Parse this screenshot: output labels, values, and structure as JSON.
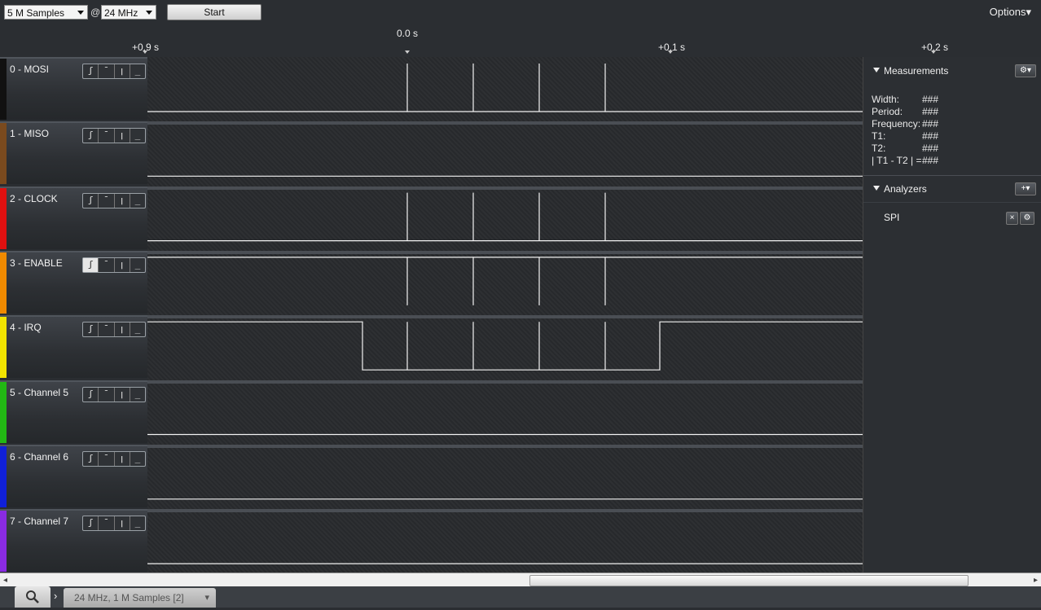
{
  "toolbar": {
    "samples_value": "5 M Samples",
    "at": "@",
    "rate_value": "24 MHz",
    "start_label": "Start",
    "options_label": "Options▾"
  },
  "ruler": {
    "ticks": [
      "+0.9 s",
      "0.0 s",
      "+0.1 s",
      "+0.2 s"
    ]
  },
  "channels": [
    {
      "name": "0 - MOSI",
      "color": "#111111"
    },
    {
      "name": "1 - MISO",
      "color": "#7a4a1e"
    },
    {
      "name": "2 - CLOCK",
      "color": "#e01010"
    },
    {
      "name": "3 - ENABLE",
      "color": "#f08a00"
    },
    {
      "name": "4 - IRQ",
      "color": "#f2e400"
    },
    {
      "name": "5 - Channel 5",
      "color": "#22b814"
    },
    {
      "name": "6 - Channel 6",
      "color": "#1020d8"
    },
    {
      "name": "7 - Channel 7",
      "color": "#8a2be2"
    }
  ],
  "trigger_glyphs": [
    "ʃ",
    "¯",
    "ꞁ",
    "_"
  ],
  "measurements": {
    "title": "Measurements",
    "rows": [
      {
        "label": "Width:",
        "value": "###"
      },
      {
        "label": "Period:",
        "value": "###"
      },
      {
        "label": "Frequency:",
        "value": "###"
      },
      {
        "label": "T1:",
        "value": "###"
      },
      {
        "label": "T2:",
        "value": "###"
      },
      {
        "label": "| T1 - T2 | =",
        "value": "###"
      }
    ]
  },
  "analyzers": {
    "title": "Analyzers",
    "items": [
      {
        "name": "SPI"
      }
    ]
  },
  "bottom": {
    "session_tab": "24 MHz, 1 M Samples [2]"
  }
}
